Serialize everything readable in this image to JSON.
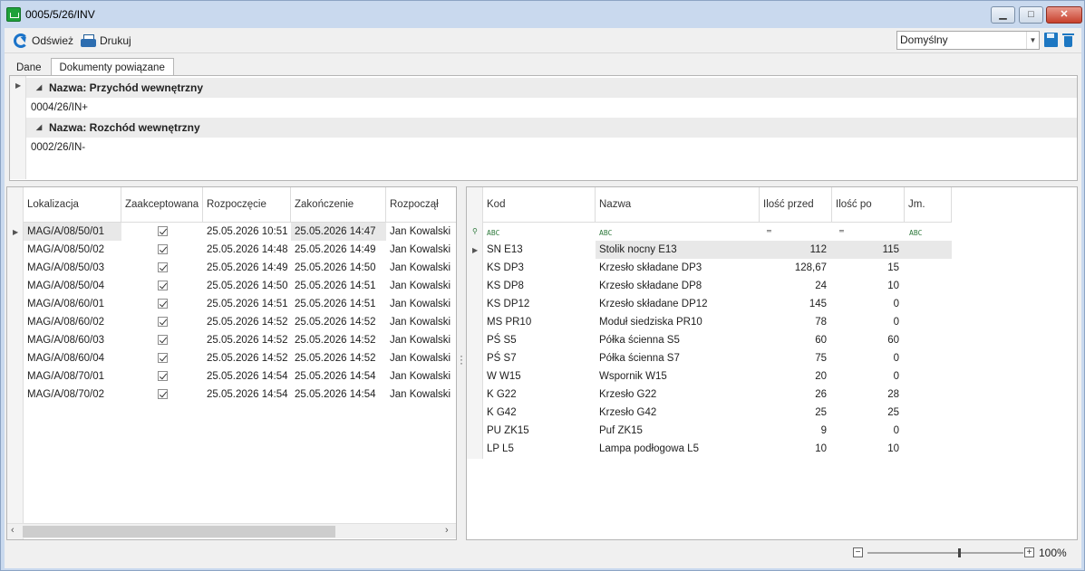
{
  "window": {
    "title": "0005/5/26/INV",
    "buttons": {
      "minimize": "▁",
      "maximize": "□",
      "close": "✕"
    }
  },
  "toolbar": {
    "refresh_label": "Odśwież",
    "print_label": "Drukuj",
    "layout_value": "Domyślny"
  },
  "tabs": [
    {
      "label": "Dane"
    },
    {
      "label": "Dokumenty powiązane"
    }
  ],
  "related": {
    "groups": [
      {
        "header": "Nazwa: Przychód wewnętrzny",
        "items": [
          "0004/26/IN+"
        ]
      },
      {
        "header": "Nazwa: Rozchód wewnętrzny",
        "items": [
          "0002/26/IN-"
        ]
      }
    ]
  },
  "left_grid": {
    "columns": [
      "Lokalizacja",
      "Zaakceptowana",
      "Rozpoczęcie",
      "Zakończenie",
      "Rozpoczął"
    ],
    "rows": [
      [
        "MAG/A/08/50/01",
        "25.05.2026 10:51",
        "25.05.2026 14:47",
        "Jan Kowalski"
      ],
      [
        "MAG/A/08/50/02",
        "25.05.2026 14:48",
        "25.05.2026 14:49",
        "Jan Kowalski"
      ],
      [
        "MAG/A/08/50/03",
        "25.05.2026 14:49",
        "25.05.2026 14:50",
        "Jan Kowalski"
      ],
      [
        "MAG/A/08/50/04",
        "25.05.2026 14:50",
        "25.05.2026 14:51",
        "Jan Kowalski"
      ],
      [
        "MAG/A/08/60/01",
        "25.05.2026 14:51",
        "25.05.2026 14:51",
        "Jan Kowalski"
      ],
      [
        "MAG/A/08/60/02",
        "25.05.2026 14:52",
        "25.05.2026 14:52",
        "Jan Kowalski"
      ],
      [
        "MAG/A/08/60/03",
        "25.05.2026 14:52",
        "25.05.2026 14:52",
        "Jan Kowalski"
      ],
      [
        "MAG/A/08/60/04",
        "25.05.2026 14:52",
        "25.05.2026 14:52",
        "Jan Kowalski"
      ],
      [
        "MAG/A/08/70/01",
        "25.05.2026 14:54",
        "25.05.2026 14:54",
        "Jan Kowalski"
      ],
      [
        "MAG/A/08/70/02",
        "25.05.2026 14:54",
        "25.05.2026 14:54",
        "Jan Kowalski"
      ]
    ]
  },
  "right_grid": {
    "columns": [
      "Kod",
      "Nazwa",
      "Ilość przed",
      "Ilość po",
      "Jm."
    ],
    "rows": [
      [
        "SN E13",
        "Stolik nocny E13",
        "112",
        "115"
      ],
      [
        "KS DP3",
        "Krzesło składane DP3",
        "128,67",
        "15"
      ],
      [
        "KS DP8",
        "Krzesło składane DP8",
        "24",
        "10"
      ],
      [
        "KS DP12",
        "Krzesło składane DP12",
        "145",
        "0"
      ],
      [
        "MS PR10",
        "Moduł siedziska PR10",
        "78",
        "0"
      ],
      [
        "PŚ S5",
        "Półka ścienna S5",
        "60",
        "60"
      ],
      [
        "PŚ S7",
        "Półka ścienna S7",
        "75",
        "0"
      ],
      [
        "W W15",
        "Wspornik W15",
        "20",
        "0"
      ],
      [
        "K G22",
        "Krzesło G22",
        "26",
        "28"
      ],
      [
        "K G42",
        "Krzesło G42",
        "25",
        "25"
      ],
      [
        "PU ZK15",
        "Puf ZK15",
        "9",
        "0"
      ],
      [
        "LP L5",
        "Lampa podłogowa L5",
        "10",
        "10"
      ]
    ]
  },
  "zoom": {
    "percent_label": "100%",
    "minus": "−",
    "plus": "+"
  }
}
